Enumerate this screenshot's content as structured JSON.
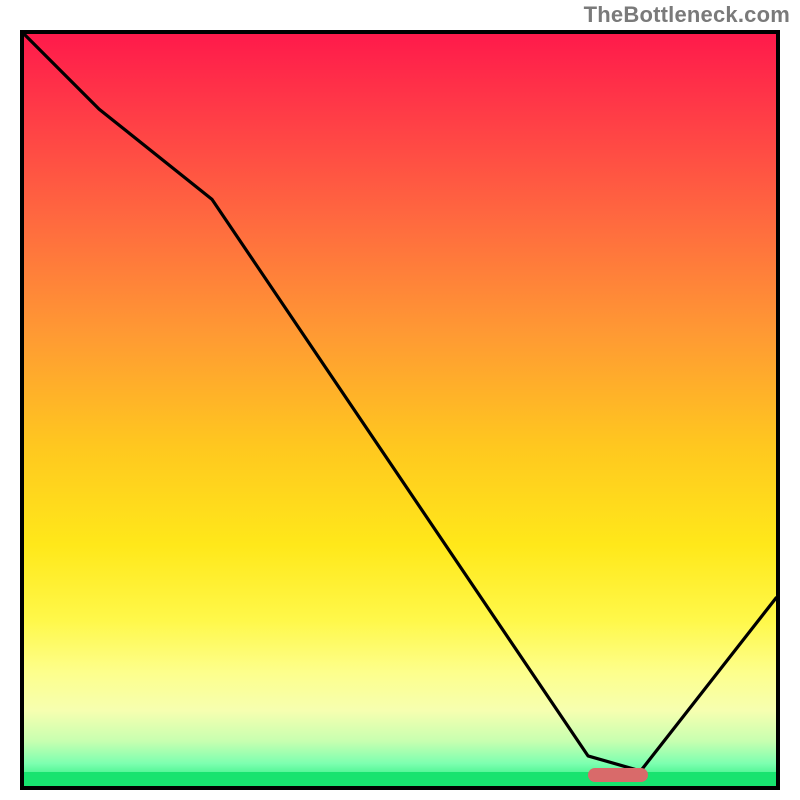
{
  "watermark": "TheBottleneck.com",
  "chart_data": {
    "type": "line",
    "title": "",
    "xlabel": "",
    "ylabel": "",
    "xlim": [
      0,
      100
    ],
    "ylim": [
      0,
      100
    ],
    "grid": false,
    "series": [
      {
        "name": "curve",
        "x": [
          0,
          10,
          25,
          75,
          82,
          100
        ],
        "y": [
          100,
          90,
          78,
          4,
          2,
          25
        ]
      }
    ],
    "optimal_band": {
      "x_start": 75,
      "x_end": 83,
      "y": 1.5
    },
    "background": {
      "type": "vertical-gradient",
      "stops": [
        {
          "pos": 0.0,
          "color": "#ff1a4b"
        },
        {
          "pos": 0.25,
          "color": "#ff6a3f"
        },
        {
          "pos": 0.55,
          "color": "#ffc81f"
        },
        {
          "pos": 0.78,
          "color": "#fff84a"
        },
        {
          "pos": 0.94,
          "color": "#c8ffb0"
        },
        {
          "pos": 1.0,
          "color": "#18e873"
        }
      ]
    }
  },
  "frame": {
    "inner_w": 752,
    "inner_h": 752
  }
}
